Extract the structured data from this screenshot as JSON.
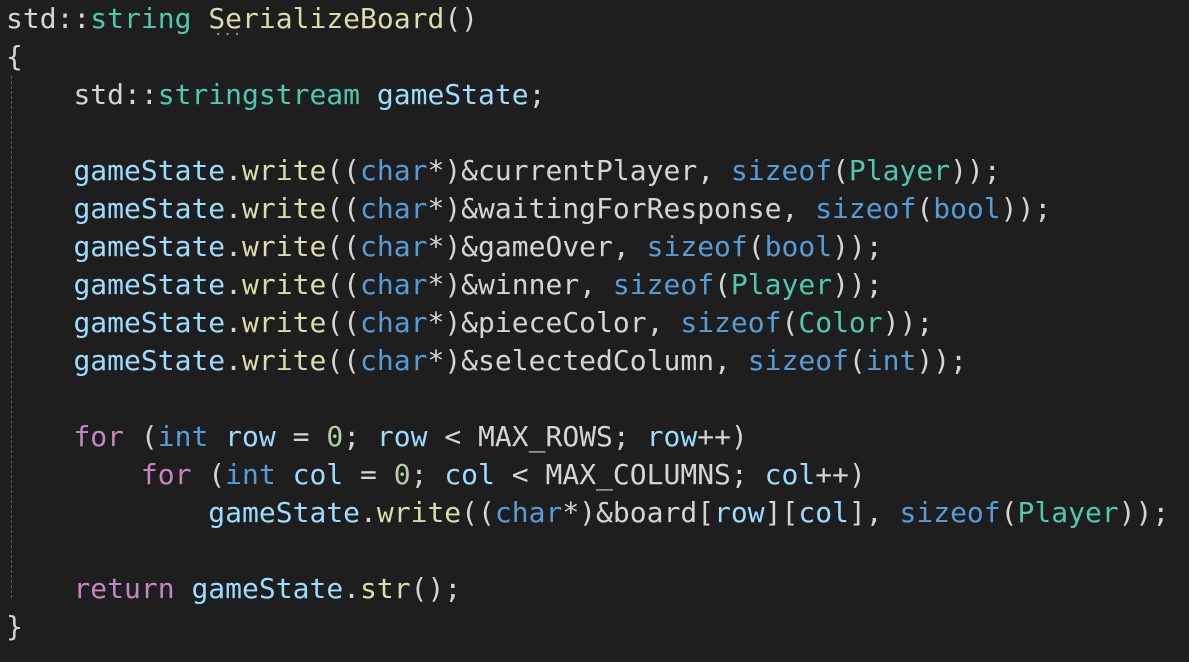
{
  "editor": {
    "language": "cpp",
    "theme": {
      "background": "#1e1e1e",
      "default": "#d4d4d4",
      "type": "#4ec9b0",
      "function": "#dcdcaa",
      "keyword": "#569cd6",
      "control": "#c586c0",
      "variable": "#9cdcfe",
      "number": "#b5cea8",
      "operator": "#d4d4d4"
    },
    "lines": [
      [
        [
          "std",
          "default"
        ],
        [
          "::",
          "default"
        ],
        [
          "string",
          "type"
        ],
        [
          " ",
          "default"
        ],
        [
          "SerializeBoard",
          "function"
        ],
        [
          "()",
          "default"
        ]
      ],
      [
        [
          "{",
          "default"
        ]
      ],
      [
        [
          "    ",
          "default"
        ],
        [
          "std",
          "default"
        ],
        [
          "::",
          "default"
        ],
        [
          "stringstream",
          "type"
        ],
        [
          " ",
          "default"
        ],
        [
          "gameState",
          "variable"
        ],
        [
          ";",
          "default"
        ]
      ],
      [
        [
          "",
          "default"
        ]
      ],
      [
        [
          "    ",
          "default"
        ],
        [
          "gameState",
          "variable"
        ],
        [
          ".",
          "default"
        ],
        [
          "write",
          "function"
        ],
        [
          "((",
          "default"
        ],
        [
          "char",
          "keyword"
        ],
        [
          "*)&currentPlayer, ",
          "default"
        ],
        [
          "sizeof",
          "keyword"
        ],
        [
          "(",
          "default"
        ],
        [
          "Player",
          "type"
        ],
        [
          "));",
          "default"
        ]
      ],
      [
        [
          "    ",
          "default"
        ],
        [
          "gameState",
          "variable"
        ],
        [
          ".",
          "default"
        ],
        [
          "write",
          "function"
        ],
        [
          "((",
          "default"
        ],
        [
          "char",
          "keyword"
        ],
        [
          "*)&waitingForResponse, ",
          "default"
        ],
        [
          "sizeof",
          "keyword"
        ],
        [
          "(",
          "default"
        ],
        [
          "bool",
          "keyword"
        ],
        [
          "));",
          "default"
        ]
      ],
      [
        [
          "    ",
          "default"
        ],
        [
          "gameState",
          "variable"
        ],
        [
          ".",
          "default"
        ],
        [
          "write",
          "function"
        ],
        [
          "((",
          "default"
        ],
        [
          "char",
          "keyword"
        ],
        [
          "*)&gameOver, ",
          "default"
        ],
        [
          "sizeof",
          "keyword"
        ],
        [
          "(",
          "default"
        ],
        [
          "bool",
          "keyword"
        ],
        [
          "));",
          "default"
        ]
      ],
      [
        [
          "    ",
          "default"
        ],
        [
          "gameState",
          "variable"
        ],
        [
          ".",
          "default"
        ],
        [
          "write",
          "function"
        ],
        [
          "((",
          "default"
        ],
        [
          "char",
          "keyword"
        ],
        [
          "*)&winner, ",
          "default"
        ],
        [
          "sizeof",
          "keyword"
        ],
        [
          "(",
          "default"
        ],
        [
          "Player",
          "type"
        ],
        [
          "));",
          "default"
        ]
      ],
      [
        [
          "    ",
          "default"
        ],
        [
          "gameState",
          "variable"
        ],
        [
          ".",
          "default"
        ],
        [
          "write",
          "function"
        ],
        [
          "((",
          "default"
        ],
        [
          "char",
          "keyword"
        ],
        [
          "*)&pieceColor, ",
          "default"
        ],
        [
          "sizeof",
          "keyword"
        ],
        [
          "(",
          "default"
        ],
        [
          "Color",
          "type"
        ],
        [
          "));",
          "default"
        ]
      ],
      [
        [
          "    ",
          "default"
        ],
        [
          "gameState",
          "variable"
        ],
        [
          ".",
          "default"
        ],
        [
          "write",
          "function"
        ],
        [
          "((",
          "default"
        ],
        [
          "char",
          "keyword"
        ],
        [
          "*)&selectedColumn, ",
          "default"
        ],
        [
          "sizeof",
          "keyword"
        ],
        [
          "(",
          "default"
        ],
        [
          "int",
          "keyword"
        ],
        [
          "));",
          "default"
        ]
      ],
      [
        [
          "",
          "default"
        ]
      ],
      [
        [
          "    ",
          "default"
        ],
        [
          "for",
          "control"
        ],
        [
          " (",
          "default"
        ],
        [
          "int",
          "keyword"
        ],
        [
          " ",
          "default"
        ],
        [
          "row",
          "variable"
        ],
        [
          " = ",
          "default"
        ],
        [
          "0",
          "number"
        ],
        [
          "; ",
          "default"
        ],
        [
          "row",
          "variable"
        ],
        [
          " < MAX_ROWS; ",
          "default"
        ],
        [
          "row",
          "variable"
        ],
        [
          "++)",
          "default"
        ]
      ],
      [
        [
          "        ",
          "default"
        ],
        [
          "for",
          "control"
        ],
        [
          " (",
          "default"
        ],
        [
          "int",
          "keyword"
        ],
        [
          " ",
          "default"
        ],
        [
          "col",
          "variable"
        ],
        [
          " = ",
          "default"
        ],
        [
          "0",
          "number"
        ],
        [
          "; ",
          "default"
        ],
        [
          "col",
          "variable"
        ],
        [
          " < MAX_COLUMNS; ",
          "default"
        ],
        [
          "col",
          "variable"
        ],
        [
          "++)",
          "default"
        ]
      ],
      [
        [
          "            ",
          "default"
        ],
        [
          "gameState",
          "variable"
        ],
        [
          ".",
          "default"
        ],
        [
          "write",
          "function"
        ],
        [
          "((",
          "default"
        ],
        [
          "char",
          "keyword"
        ],
        [
          "*)&board[",
          "default"
        ],
        [
          "row",
          "variable"
        ],
        [
          "][",
          "default"
        ],
        [
          "col",
          "variable"
        ],
        [
          "], ",
          "default"
        ],
        [
          "sizeof",
          "keyword"
        ],
        [
          "(",
          "default"
        ],
        [
          "Player",
          "type"
        ],
        [
          "));",
          "default"
        ]
      ],
      [
        [
          "",
          "default"
        ]
      ],
      [
        [
          "    ",
          "default"
        ],
        [
          "return",
          "control"
        ],
        [
          " ",
          "default"
        ],
        [
          "gameState",
          "variable"
        ],
        [
          ".",
          "default"
        ],
        [
          "str",
          "function"
        ],
        [
          "();",
          "default"
        ]
      ],
      [
        [
          "}",
          "default"
        ]
      ]
    ],
    "squiggle": "···"
  }
}
